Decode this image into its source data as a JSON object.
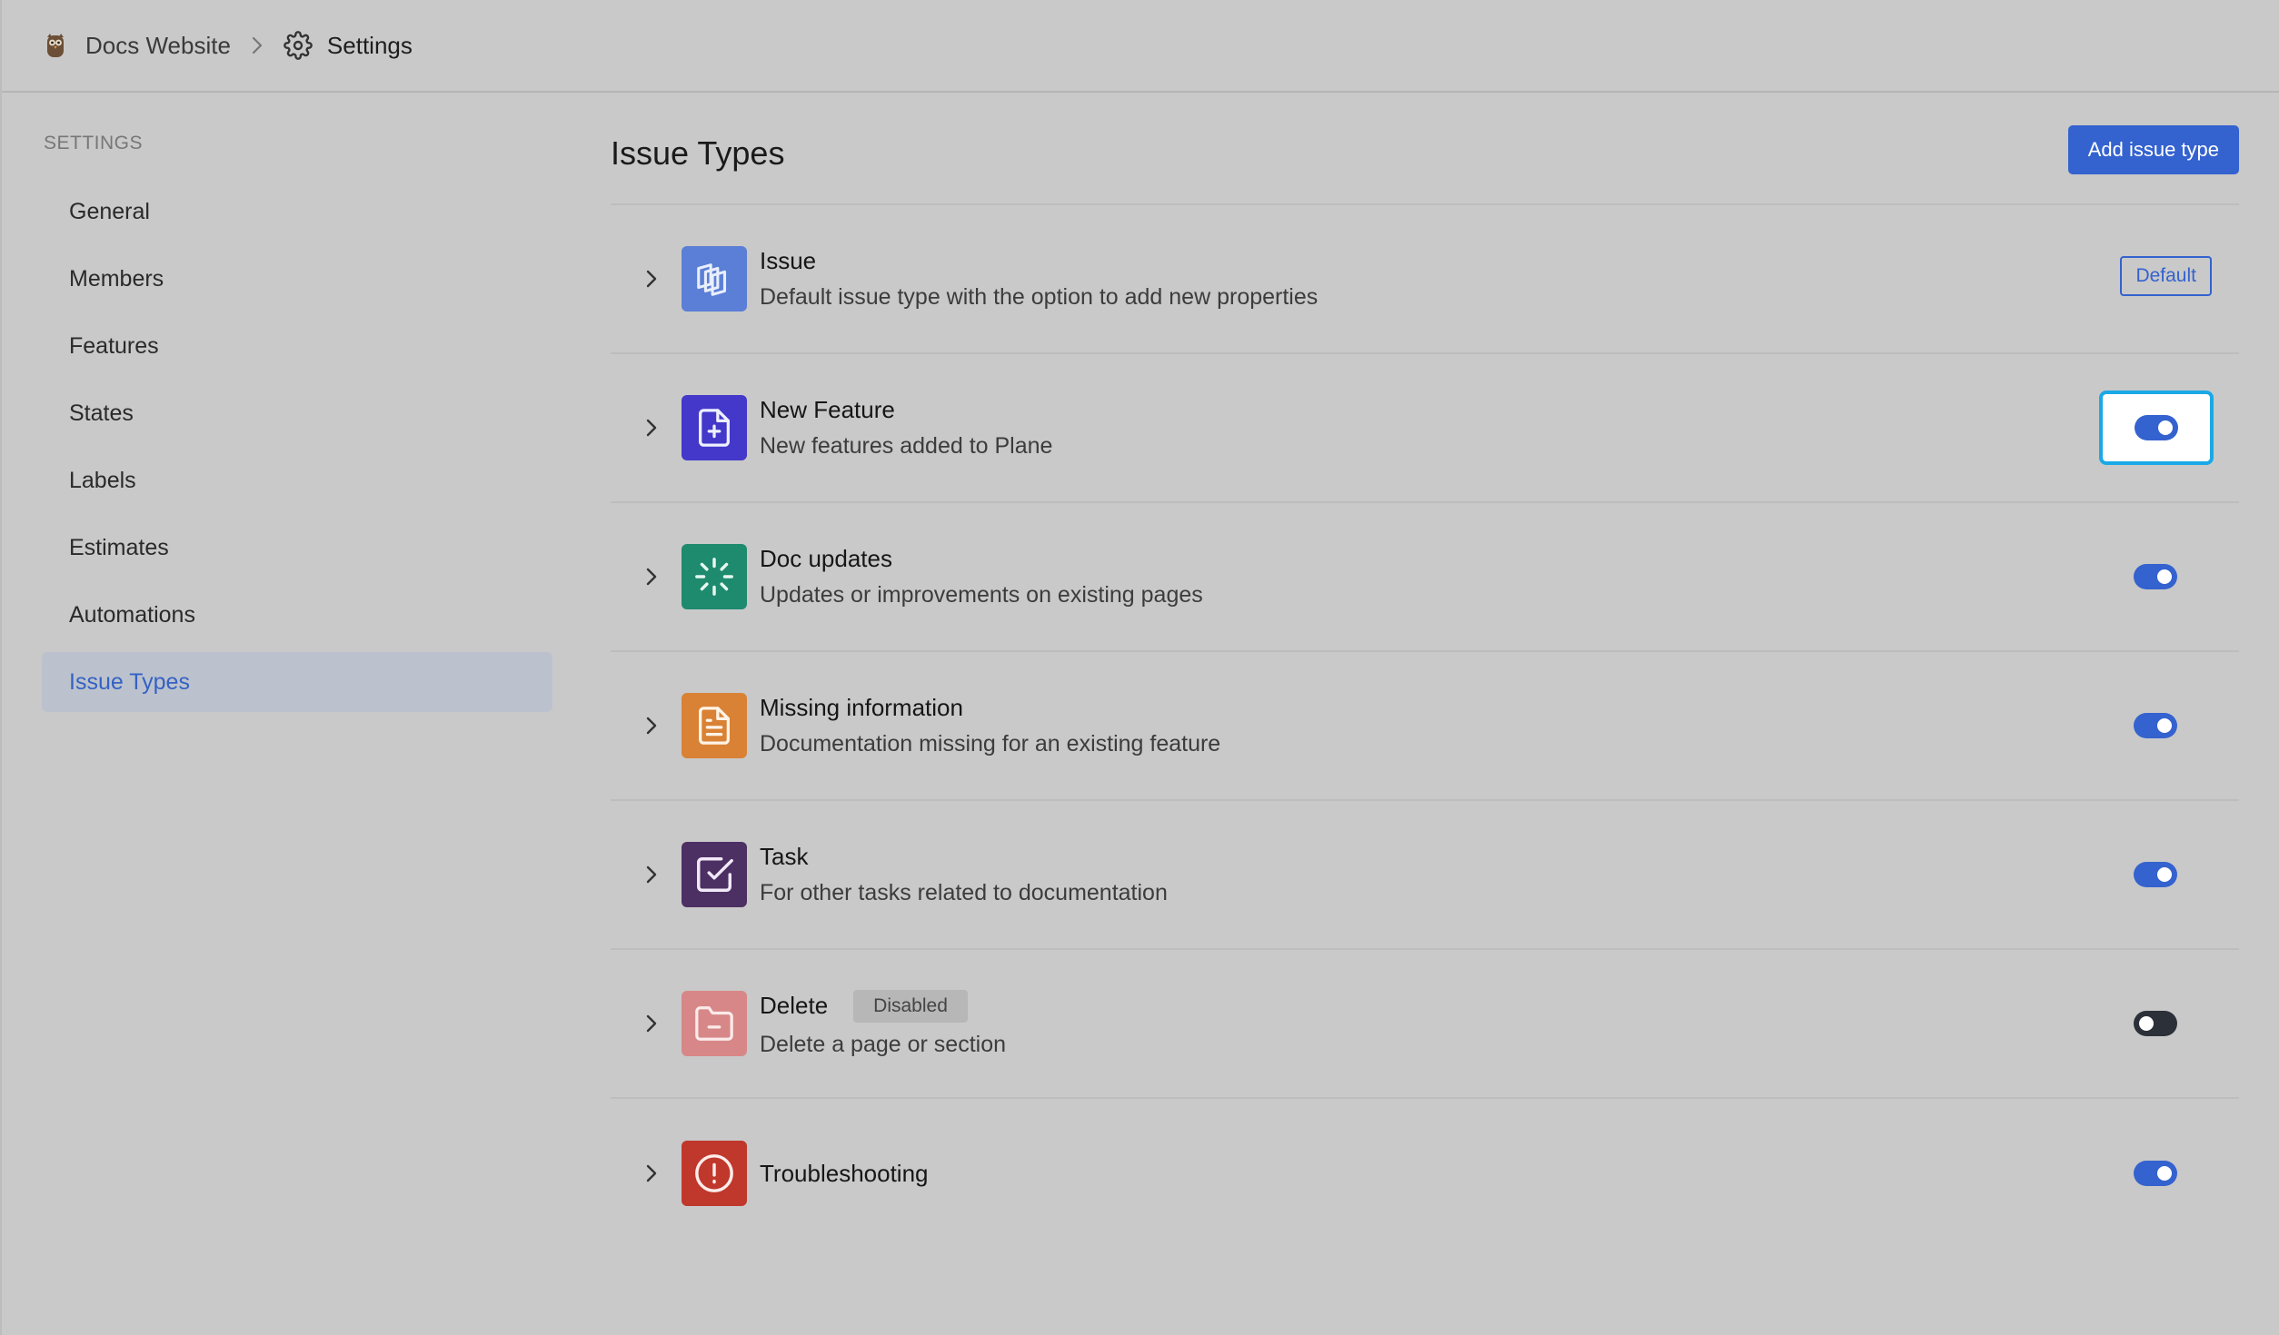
{
  "breadcrumb": {
    "project": "Docs Website",
    "current": "Settings"
  },
  "sidebar": {
    "section_title": "SETTINGS",
    "items": [
      {
        "label": "General"
      },
      {
        "label": "Members"
      },
      {
        "label": "Features"
      },
      {
        "label": "States"
      },
      {
        "label": "Labels"
      },
      {
        "label": "Estimates"
      },
      {
        "label": "Automations"
      },
      {
        "label": "Issue Types",
        "active": true
      }
    ]
  },
  "main": {
    "title": "Issue Types",
    "add_button": "Add issue type",
    "default_badge": "Default",
    "disabled_badge": "Disabled",
    "issue_types": [
      {
        "name": "Issue",
        "description": "Default issue type with the option to add new properties",
        "icon": "layers-icon",
        "color": "#5b7fd6",
        "default": true
      },
      {
        "name": "New Feature",
        "description": "New features added to Plane",
        "icon": "file-plus-icon",
        "color": "#4338ca",
        "enabled": true,
        "focused": true
      },
      {
        "name": "Doc updates",
        "description": "Updates or improvements on existing pages",
        "icon": "loader-icon",
        "color": "#1e8a6e",
        "enabled": true
      },
      {
        "name": "Missing information",
        "description": "Documentation missing for an existing feature",
        "icon": "file-text-icon",
        "color": "#d98235",
        "enabled": true
      },
      {
        "name": "Task",
        "description": "For other tasks related to documentation",
        "icon": "check-square-icon",
        "color": "#4c2f63",
        "enabled": true
      },
      {
        "name": "Delete",
        "description": "Delete a page or section",
        "icon": "folder-minus-icon",
        "color": "#d78787",
        "enabled": false
      },
      {
        "name": "Troubleshooting",
        "description": "",
        "icon": "alert-circle-icon",
        "color": "#c0372b",
        "enabled": true
      }
    ]
  },
  "colors": {
    "accent": "#3462cf",
    "background": "#c9c9c9",
    "focus": "#1aa9e6"
  }
}
